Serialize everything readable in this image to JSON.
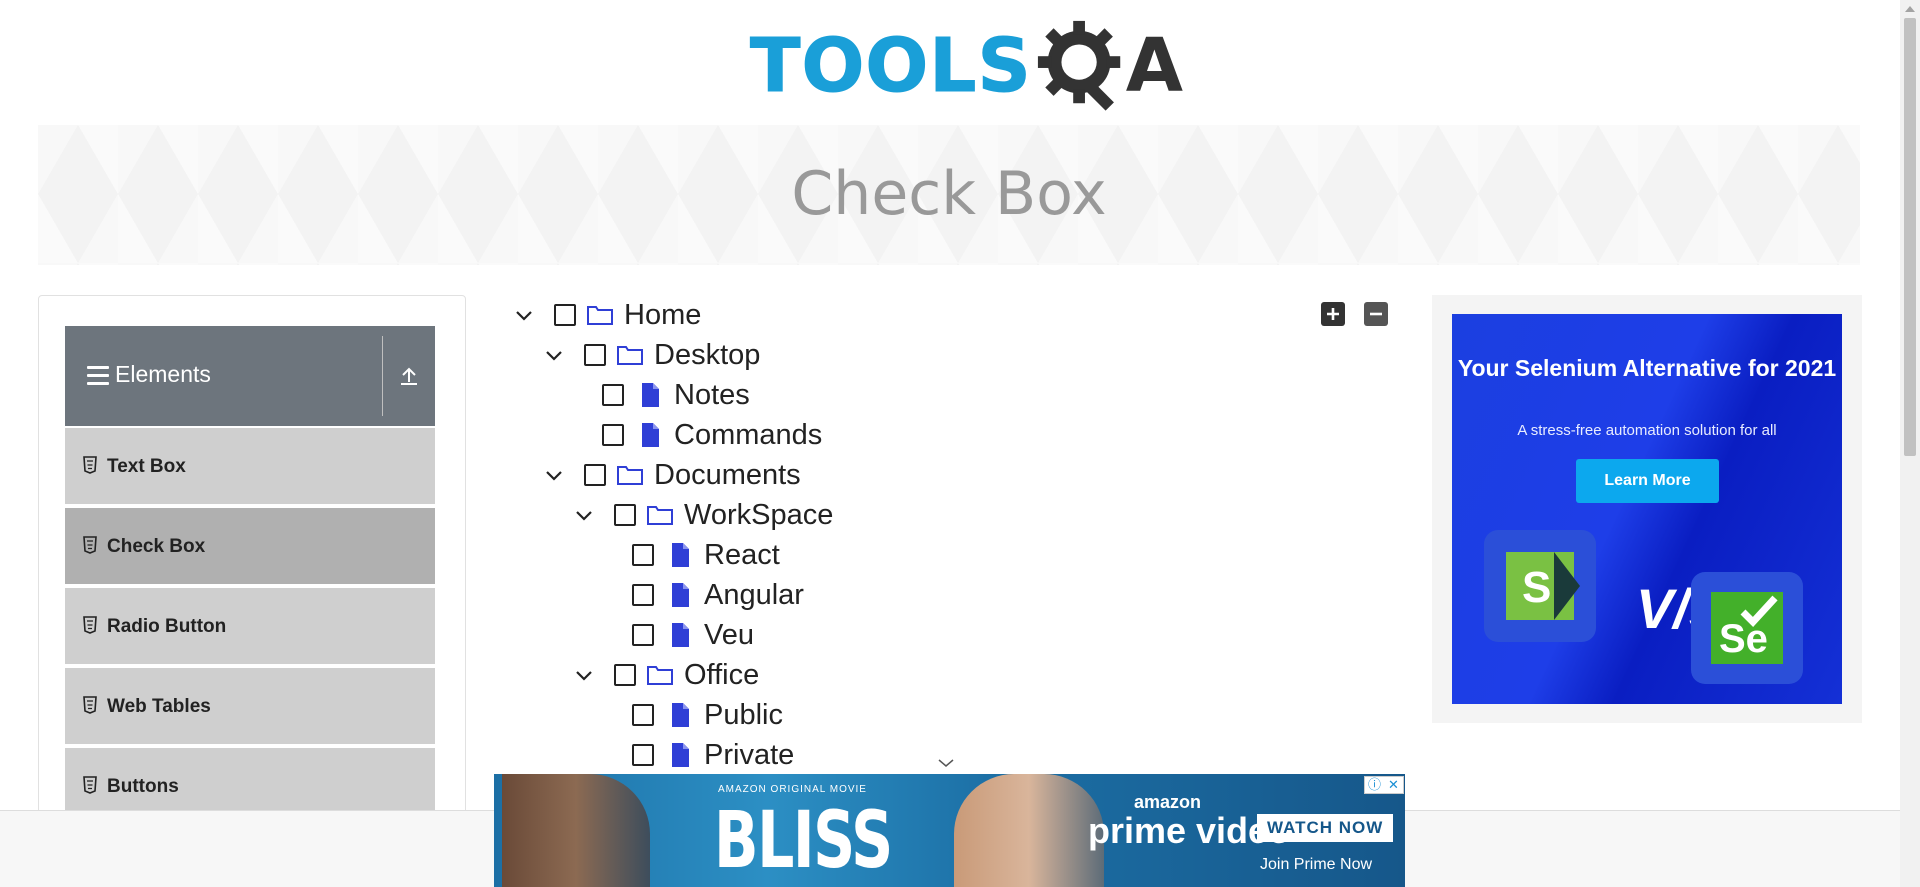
{
  "logo": {
    "text_left": "TOOLS",
    "text_right": "A"
  },
  "banner": {
    "title": "Check Box"
  },
  "sidebar": {
    "group_title": "Elements",
    "items": [
      {
        "label": "Text Box"
      },
      {
        "label": "Check Box"
      },
      {
        "label": "Radio Button"
      },
      {
        "label": "Web Tables"
      },
      {
        "label": "Buttons"
      }
    ]
  },
  "tree": {
    "nodes": [
      {
        "label": "Home"
      },
      {
        "label": "Desktop"
      },
      {
        "label": "Notes"
      },
      {
        "label": "Commands"
      },
      {
        "label": "Documents"
      },
      {
        "label": "WorkSpace"
      },
      {
        "label": "React"
      },
      {
        "label": "Angular"
      },
      {
        "label": "Veu"
      },
      {
        "label": "Office"
      },
      {
        "label": "Public"
      },
      {
        "label": "Private"
      }
    ]
  },
  "right_ad": {
    "headline": "Your Selenium Alternative for 2021",
    "subtext": "A stress-free automation solution for all",
    "button_label": "Learn More",
    "vs_text": "V/s"
  },
  "bottom_ad": {
    "tag": "AMAZON ORIGINAL MOVIE",
    "title": "BLISS",
    "brand_top": "amazon",
    "brand_main": "prime video",
    "cta": "WATCH NOW",
    "join_text": "Join Prime Now"
  },
  "colors": {
    "header_gray": "#6d757d",
    "menu_item": "#cfcfcf",
    "menu_item_active": "#b0b0b0",
    "logo_blue": "#1a9fd8",
    "tree_icon_blue": "#2f3fd6",
    "ad_blue": "#1b3fe0",
    "ad_button": "#0ca8ee"
  }
}
